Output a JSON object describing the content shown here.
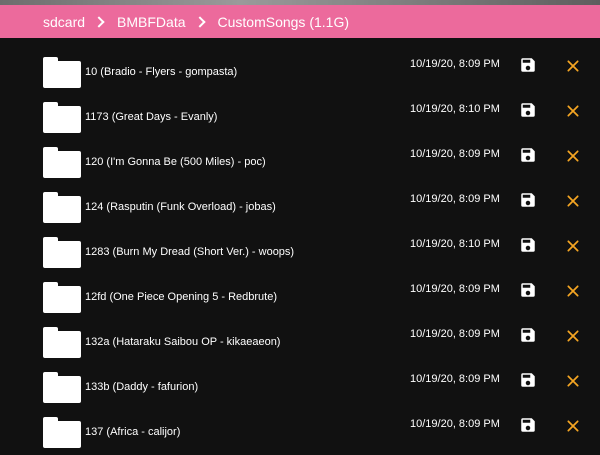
{
  "breadcrumb": {
    "items": [
      "sdcard",
      "BMBFData",
      "CustomSongs (1.1G)"
    ]
  },
  "colors": {
    "header_bg": "#ec6a9c",
    "background": "#111111",
    "close_icon": "#f5a623",
    "text": "#ffffff"
  },
  "rows": [
    {
      "name": "10 (Bradio - Flyers - gompasta)",
      "date": "10/19/20, 8:09 PM"
    },
    {
      "name": "1173 (Great Days - Evanly)",
      "date": "10/19/20, 8:10 PM"
    },
    {
      "name": "120 (I'm Gonna Be (500 Miles) - poc)",
      "date": "10/19/20, 8:09 PM"
    },
    {
      "name": "124 (Rasputin (Funk Overload) - jobas)",
      "date": "10/19/20, 8:09 PM"
    },
    {
      "name": "1283 (Burn My Dread (Short Ver.) - woops)",
      "date": "10/19/20, 8:10 PM"
    },
    {
      "name": "12fd (One Piece Opening 5 - Redbrute)",
      "date": "10/19/20, 8:09 PM"
    },
    {
      "name": "132a (Hataraku Saibou OP - kikaeaeon)",
      "date": "10/19/20, 8:09 PM"
    },
    {
      "name": "133b (Daddy - fafurion)",
      "date": "10/19/20, 8:09 PM"
    },
    {
      "name": "137 (Africa - calijor)",
      "date": "10/19/20, 8:09 PM"
    }
  ],
  "icons": {
    "folder": "folder-icon",
    "save": "save-icon",
    "close": "close-icon"
  }
}
